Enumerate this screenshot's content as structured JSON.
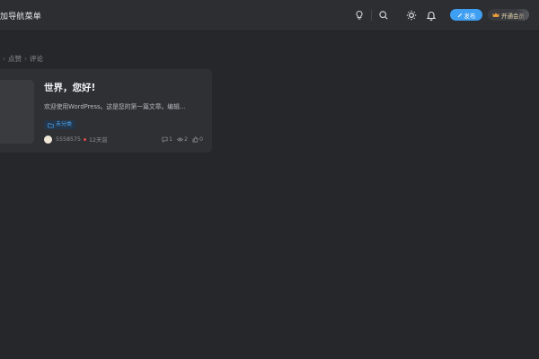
{
  "header": {
    "nav_title": "加导航菜单",
    "publish_label": "发布",
    "vip_label": "开通会员",
    "icons": [
      "lightbulb-icon",
      "search-icon",
      "theme-toggle-icon",
      "bell-icon"
    ]
  },
  "breadcrumb": {
    "items": [
      "点赞",
      "评论"
    ],
    "separator": "›"
  },
  "post": {
    "title": "世界，您好!",
    "excerpt": "欢迎使用WordPress。这是您的第一篇文章。编辑...",
    "category": "未分类",
    "author": "5558575",
    "time": "12天前",
    "comments": "1",
    "views": "2",
    "likes": "0"
  },
  "colors": {
    "background": "#26272b",
    "topbar": "#2d2e32",
    "card": "#2f3034",
    "accent_blue": "#3f9ff2",
    "tag_text": "#4aa3f0",
    "dot_red": "#e24b4b"
  }
}
